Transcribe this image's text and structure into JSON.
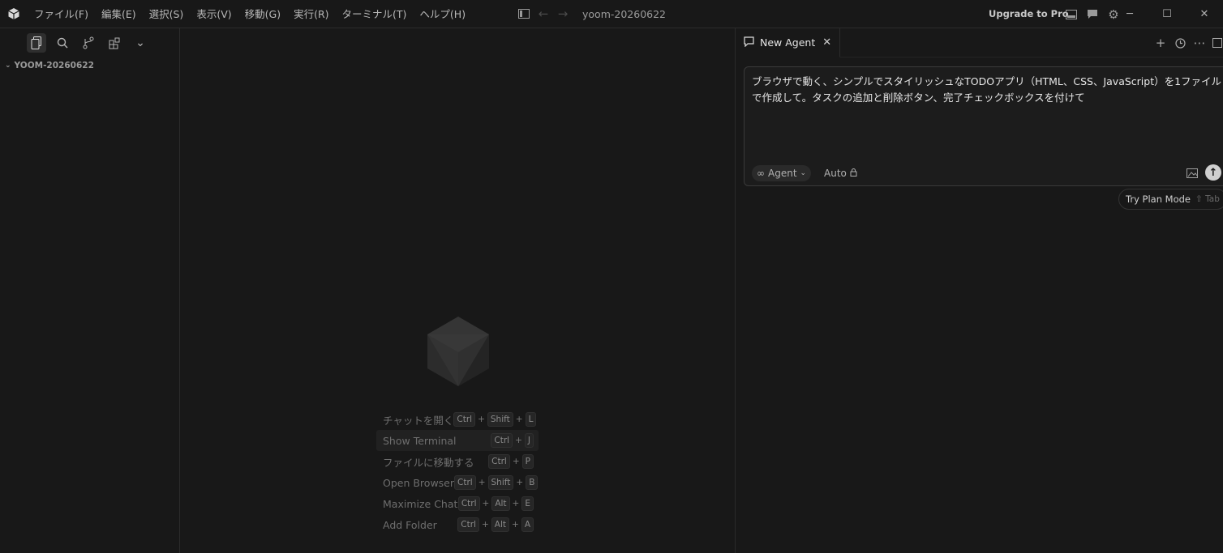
{
  "app": {
    "menu": [
      "ファイル(F)",
      "編集(E)",
      "選択(S)",
      "表示(V)",
      "移動(G)",
      "実行(R)",
      "ターミナル(T)",
      "ヘルプ(H)"
    ],
    "window_title": "yoom-20260622",
    "upgrade_label": "Upgrade to Pro"
  },
  "sidebar": {
    "folder_name": "YOOM-20260622"
  },
  "welcome": {
    "shortcuts": [
      {
        "label": "チャットを開く",
        "keys": [
          "Ctrl",
          "Shift",
          "L"
        ]
      },
      {
        "label": "Show Terminal",
        "keys": [
          "Ctrl",
          "J"
        ]
      },
      {
        "label": "ファイルに移動する",
        "keys": [
          "Ctrl",
          "P"
        ]
      },
      {
        "label": "Open Browser",
        "keys": [
          "Ctrl",
          "Shift",
          "B"
        ]
      },
      {
        "label": "Maximize Chat",
        "keys": [
          "Ctrl",
          "Alt",
          "E"
        ]
      },
      {
        "label": "Add Folder",
        "keys": [
          "Ctrl",
          "Alt",
          "A"
        ]
      }
    ]
  },
  "chat": {
    "tab_label": "New Agent",
    "prompt_text": "ブラウザで動く、シンプルでスタイリッシュなTODOアプリ（HTML、CSS、JavaScript）を1ファイルで作成して。タスクの追加と削除ボタン、完了チェックボックスを付けて",
    "mode_label": "Agent",
    "model_label": "Auto",
    "plan_mode_label": "Try Plan Mode",
    "plan_mode_hint": "⇧ Tab"
  },
  "colors": {
    "background": "#181818",
    "border": "#2b2b2b",
    "send_button": "#cfcfcf"
  }
}
